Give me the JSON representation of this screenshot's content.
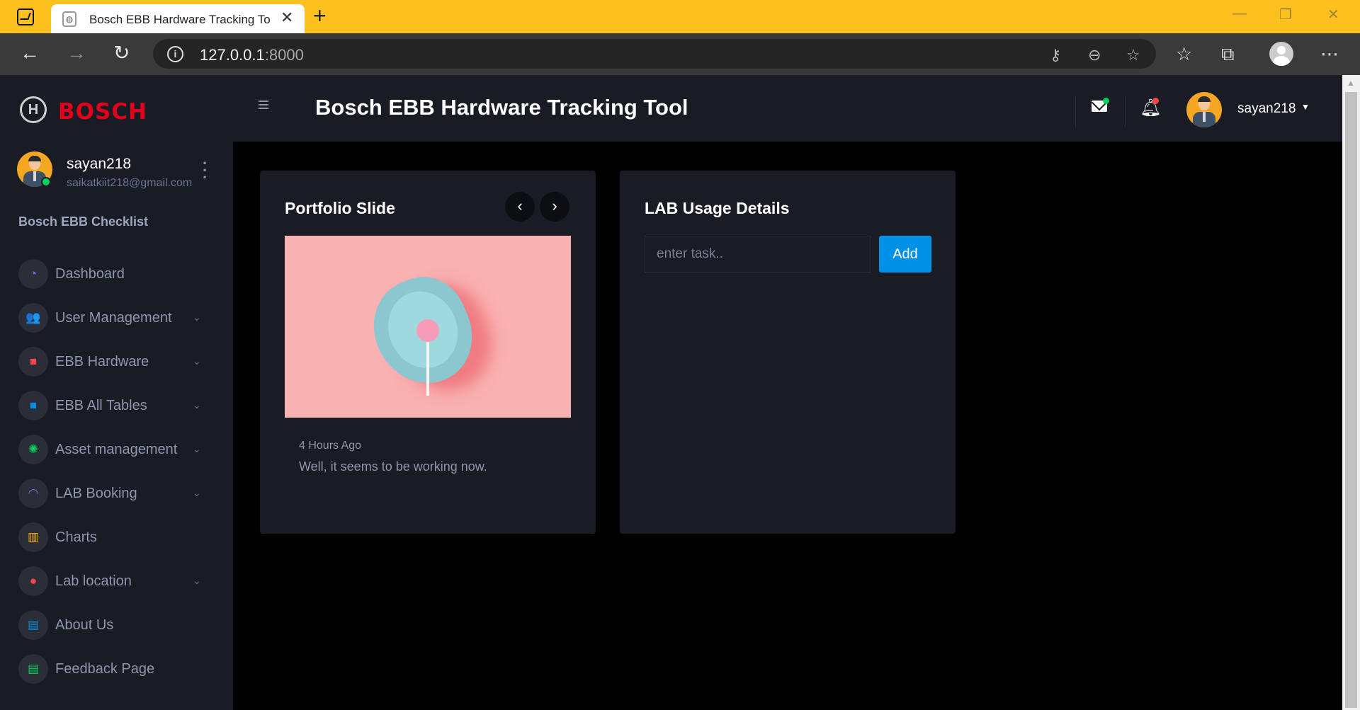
{
  "browser": {
    "tab_title": "Bosch EBB Hardware Tracking To",
    "url_host": "127.0.0.1",
    "url_port": ":8000"
  },
  "brand": {
    "name": "BOSCH"
  },
  "sidebar": {
    "profile": {
      "name": "sayan218",
      "email": "saikatkiit218@gmail.com"
    },
    "section_label": "Bosch EBB Checklist",
    "items": [
      {
        "label": "Dashboard",
        "icon": "speedometer-icon",
        "glyph": "◔",
        "color": "#8f5fe8",
        "chevron": false
      },
      {
        "label": "User Management",
        "icon": "users-icon",
        "glyph": "👥",
        "color": "#ffab00",
        "chevron": true
      },
      {
        "label": "EBB Hardware",
        "icon": "briefcase-icon",
        "glyph": "■",
        "color": "#fc424a",
        "chevron": true
      },
      {
        "label": "EBB All Tables",
        "icon": "folder-icon",
        "glyph": "■",
        "color": "#0090e7",
        "chevron": true
      },
      {
        "label": "Asset management",
        "icon": "chip-icon",
        "glyph": "✺",
        "color": "#00d25b",
        "chevron": true
      },
      {
        "label": "LAB Booking",
        "icon": "rainbow-icon",
        "glyph": "◠",
        "color": "#8f5fe8",
        "chevron": true
      },
      {
        "label": "Charts",
        "icon": "chart-icon",
        "glyph": "▥",
        "color": "#ffab00",
        "chevron": false
      },
      {
        "label": "Lab location",
        "icon": "map-pin-icon",
        "glyph": "●",
        "color": "#fc424a",
        "chevron": true
      },
      {
        "label": "About Us",
        "icon": "document-icon",
        "glyph": "▤",
        "color": "#0090e7",
        "chevron": false
      },
      {
        "label": "Feedback Page",
        "icon": "document-icon",
        "glyph": "▤",
        "color": "#00d25b",
        "chevron": false
      }
    ]
  },
  "topbar": {
    "title": "Bosch EBB Hardware Tracking Tool",
    "username": "sayan218"
  },
  "portfolio": {
    "title": "Portfolio Slide",
    "time": "4 Hours Ago",
    "text": "Well, it seems to be working now."
  },
  "lab_usage": {
    "title": "LAB Usage Details",
    "input_placeholder": "enter task..",
    "add_label": "Add"
  },
  "colors": {
    "accent": "#0090e7",
    "sidebar_bg": "#191c24",
    "brand_red": "#e2001a",
    "browser_frame": "#fdc01f"
  }
}
